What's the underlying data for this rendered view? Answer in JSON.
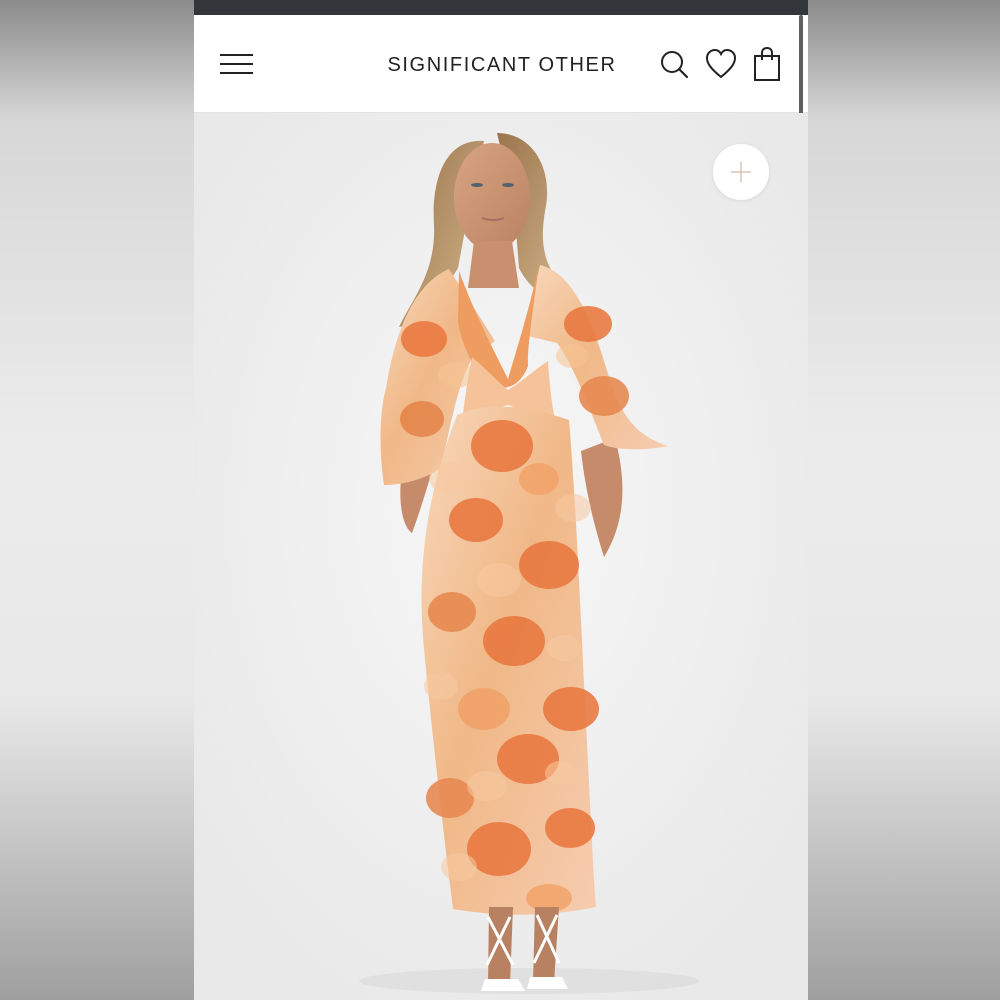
{
  "header": {
    "brand": "SIGNIFICANT OTHER",
    "icons": {
      "menu": "hamburger-menu-icon",
      "search": "search-icon",
      "wishlist": "heart-icon",
      "bag": "shopping-bag-icon"
    }
  },
  "product_image": {
    "zoom_icon": "plus-icon"
  },
  "colors": {
    "status_bar": "#33363a",
    "header_bg": "#ffffff",
    "text": "#222222",
    "dress_orange": "#e9783f",
    "dress_peach": "#f6c59b",
    "zoom_plus": "#d9c7b8"
  }
}
